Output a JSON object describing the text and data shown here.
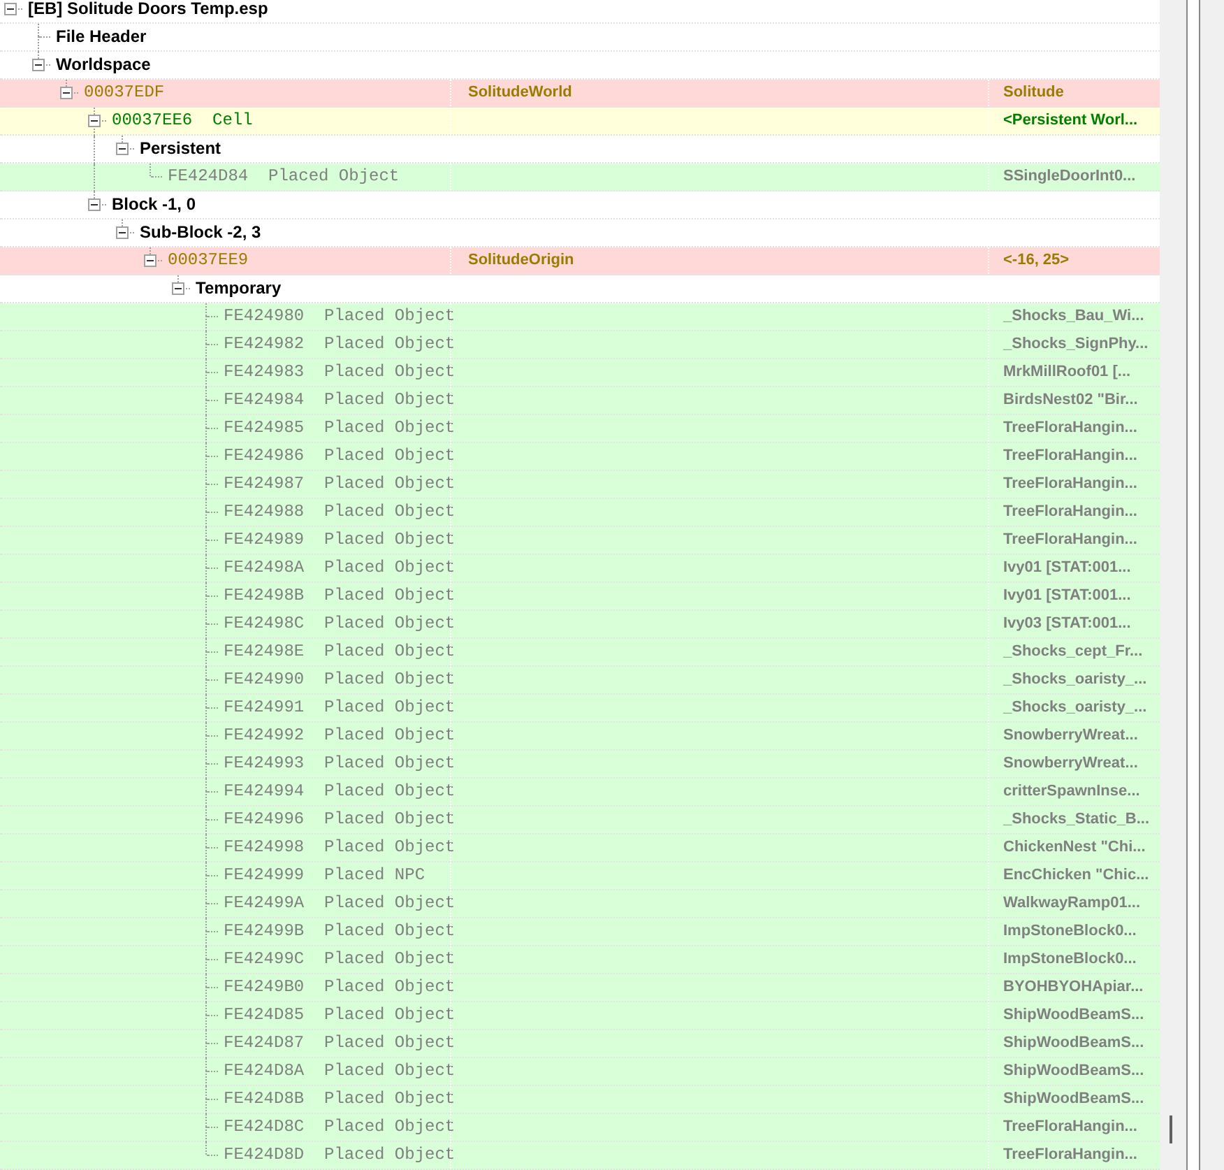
{
  "tree": [
    {
      "label": "[EB] Solitude Doors Temp.esp",
      "kind": "header",
      "expanded": true,
      "children": [
        {
          "label": "File Header",
          "kind": "header"
        },
        {
          "label": "Worldspace",
          "kind": "header",
          "expanded": true,
          "children": [
            {
              "label": "00037EDF",
              "kind": "record",
              "color": "#ffd8d8",
              "column_2": "SolitudeWorld",
              "column_3": "Solitude",
              "expanded": true,
              "children": [
                {
                  "label": "00037EE6  Cell",
                  "kind": "record",
                  "color": "#ffffdc",
                  "column_3": "<Persistent Worl...",
                  "expanded": true,
                  "children": [
                    {
                      "label": "Persistent",
                      "kind": "header",
                      "expanded": true,
                      "children": [
                        {
                          "label": "FE424D84  Placed Object",
                          "kind": "record",
                          "color": "#d8ffd8",
                          "column_3": "SSingleDoorInt0..."
                        }
                      ]
                    }
                  ]
                },
                {
                  "label": "Block -1, 0",
                  "kind": "header",
                  "expanded": true,
                  "children": [
                    {
                      "label": "Sub-Block -2, 3",
                      "kind": "header",
                      "expanded": true,
                      "children": [
                        {
                          "label": "00037EE9",
                          "kind": "record",
                          "color": "#ffd8d8",
                          "column_2": "SolitudeOrigin",
                          "column_3": "<-16, 25>",
                          "expanded": true,
                          "children": [
                            {
                              "label": "Temporary",
                              "kind": "header",
                              "expanded": true,
                              "children": [
                                {
                                  "label": "FE424980  Placed Object",
                                  "kind": "record",
                                  "color": "#d8ffd8",
                                  "column_3": "_Shocks_Bau_Wi..."
                                },
                                {
                                  "label": "FE424982  Placed Object",
                                  "kind": "record",
                                  "color": "#d8ffd8",
                                  "column_3": "_Shocks_SignPhy..."
                                },
                                {
                                  "label": "FE424983  Placed Object",
                                  "kind": "record",
                                  "color": "#d8ffd8",
                                  "column_3": "MrkMillRoof01 [..."
                                },
                                {
                                  "label": "FE424984  Placed Object",
                                  "kind": "record",
                                  "color": "#d8ffd8",
                                  "column_3": "BirdsNest02 \"Bir..."
                                },
                                {
                                  "label": "FE424985  Placed Object",
                                  "kind": "record",
                                  "color": "#d8ffd8",
                                  "column_3": "TreeFloraHangin..."
                                },
                                {
                                  "label": "FE424986  Placed Object",
                                  "kind": "record",
                                  "color": "#d8ffd8",
                                  "column_3": "TreeFloraHangin..."
                                },
                                {
                                  "label": "FE424987  Placed Object",
                                  "kind": "record",
                                  "color": "#d8ffd8",
                                  "column_3": "TreeFloraHangin..."
                                },
                                {
                                  "label": "FE424988  Placed Object",
                                  "kind": "record",
                                  "color": "#d8ffd8",
                                  "column_3": "TreeFloraHangin..."
                                },
                                {
                                  "label": "FE424989  Placed Object",
                                  "kind": "record",
                                  "color": "#d8ffd8",
                                  "column_3": "TreeFloraHangin..."
                                },
                                {
                                  "label": "FE42498A  Placed Object",
                                  "kind": "record",
                                  "color": "#d8ffd8",
                                  "column_3": "Ivy01 [STAT:001..."
                                },
                                {
                                  "label": "FE42498B  Placed Object",
                                  "kind": "record",
                                  "color": "#d8ffd8",
                                  "column_3": "Ivy01 [STAT:001..."
                                },
                                {
                                  "label": "FE42498C  Placed Object",
                                  "kind": "record",
                                  "color": "#d8ffd8",
                                  "column_3": "Ivy03 [STAT:001..."
                                },
                                {
                                  "label": "FE42498E  Placed Object",
                                  "kind": "record",
                                  "color": "#d8ffd8",
                                  "column_3": "_Shocks_cept_Fr..."
                                },
                                {
                                  "label": "FE424990  Placed Object",
                                  "kind": "record",
                                  "color": "#d8ffd8",
                                  "column_3": "_Shocks_oaristy_..."
                                },
                                {
                                  "label": "FE424991  Placed Object",
                                  "kind": "record",
                                  "color": "#d8ffd8",
                                  "column_3": "_Shocks_oaristy_..."
                                },
                                {
                                  "label": "FE424992  Placed Object",
                                  "kind": "record",
                                  "color": "#d8ffd8",
                                  "column_3": "SnowberryWreat..."
                                },
                                {
                                  "label": "FE424993  Placed Object",
                                  "kind": "record",
                                  "color": "#d8ffd8",
                                  "column_3": "SnowberryWreat..."
                                },
                                {
                                  "label": "FE424994  Placed Object",
                                  "kind": "record",
                                  "color": "#d8ffd8",
                                  "column_3": "critterSpawnInse..."
                                },
                                {
                                  "label": "FE424996  Placed Object",
                                  "kind": "record",
                                  "color": "#d8ffd8",
                                  "column_3": "_Shocks_Static_B..."
                                },
                                {
                                  "label": "FE424998  Placed Object",
                                  "kind": "record",
                                  "color": "#d8ffd8",
                                  "column_3": "ChickenNest \"Chi..."
                                },
                                {
                                  "label": "FE424999  Placed NPC",
                                  "kind": "record",
                                  "color": "#d8ffd8",
                                  "column_3": "EncChicken \"Chic..."
                                },
                                {
                                  "label": "FE42499A  Placed Object",
                                  "kind": "record",
                                  "color": "#d8ffd8",
                                  "column_3": "WalkwayRamp01..."
                                },
                                {
                                  "label": "FE42499B  Placed Object",
                                  "kind": "record",
                                  "color": "#d8ffd8",
                                  "column_3": "ImpStoneBlock0..."
                                },
                                {
                                  "label": "FE42499C  Placed Object",
                                  "kind": "record",
                                  "color": "#d8ffd8",
                                  "column_3": "ImpStoneBlock0..."
                                },
                                {
                                  "label": "FE4249B0  Placed Object",
                                  "kind": "record",
                                  "color": "#d8ffd8",
                                  "column_3": "BYOHBYOHApiar..."
                                },
                                {
                                  "label": "FE424D85  Placed Object",
                                  "kind": "record",
                                  "color": "#d8ffd8",
                                  "column_3": "ShipWoodBeamS..."
                                },
                                {
                                  "label": "FE424D87  Placed Object",
                                  "kind": "record",
                                  "color": "#d8ffd8",
                                  "column_3": "ShipWoodBeamS..."
                                },
                                {
                                  "label": "FE424D8A  Placed Object",
                                  "kind": "record",
                                  "color": "#d8ffd8",
                                  "column_3": "ShipWoodBeamS..."
                                },
                                {
                                  "label": "FE424D8B  Placed Object",
                                  "kind": "record",
                                  "color": "#d8ffd8",
                                  "column_3": "ShipWoodBeamS..."
                                },
                                {
                                  "label": "FE424D8C  Placed Object",
                                  "kind": "record",
                                  "color": "#d8ffd8",
                                  "column_3": "TreeFloraHangin..."
                                },
                                {
                                  "label": "FE424D8D  Placed Object",
                                  "kind": "record",
                                  "color": "#d8ffd8",
                                  "column_3": "TreeFloraHangin..."
                                }
                              ]
                            }
                          ]
                        }
                      ]
                    }
                  ]
                }
              ]
            }
          ]
        }
      ]
    }
  ]
}
